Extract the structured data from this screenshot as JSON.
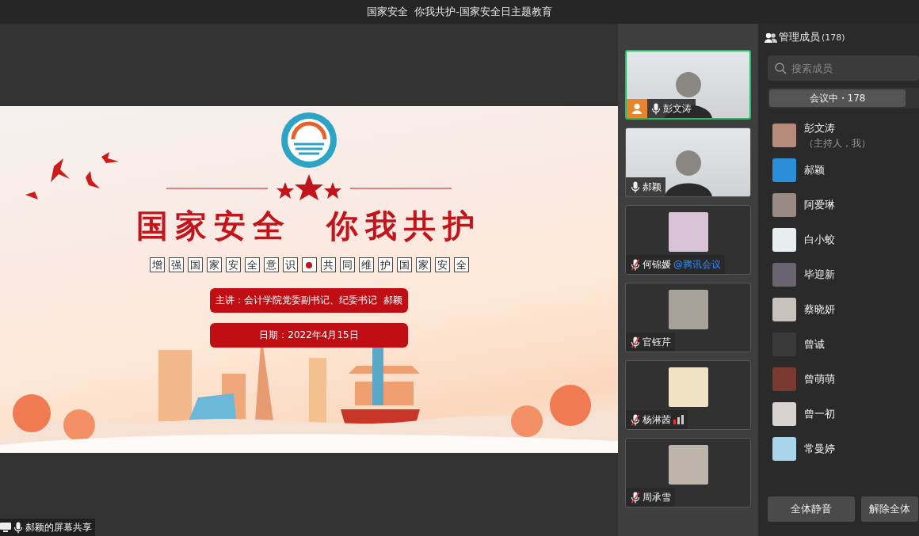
{
  "window": {
    "title": "国家安全  你我共护-国家安全日主题教育"
  },
  "slide": {
    "title_left": "国家安全",
    "title_right": "你我共护",
    "subtitle_left": "增强国家安全意识",
    "subtitle_right": "共同维护国家安全",
    "speaker": "主讲：会计学院党委副书记、纪委书记  郝颖",
    "date": "日期：2022年4月15日"
  },
  "share": {
    "label": "郝颖的屏幕共享"
  },
  "videos": [
    {
      "name": "彭文涛",
      "kind": "camera",
      "active": true,
      "host": true,
      "muted": false,
      "signal": false
    },
    {
      "name": "郝颖",
      "kind": "camera",
      "active": false,
      "host": false,
      "muted": false,
      "signal": false
    },
    {
      "name": "何锦媛",
      "suffix": "@腾讯会议",
      "kind": "avatar",
      "active": false,
      "host": false,
      "muted": true,
      "signal": false
    },
    {
      "name": "官钰芹",
      "kind": "avatar",
      "active": false,
      "host": false,
      "muted": true,
      "signal": false
    },
    {
      "name": "杨淋茜",
      "kind": "avatar",
      "active": false,
      "host": false,
      "muted": true,
      "signal": true
    },
    {
      "name": "周承雪",
      "kind": "avatar",
      "active": false,
      "host": false,
      "muted": true,
      "signal": false
    }
  ],
  "members": {
    "title": "管理成员",
    "count": "(178)",
    "search": {
      "placeholder": "搜索成员"
    },
    "tabs": [
      {
        "label": "会议中・178",
        "selected": true
      }
    ],
    "items": [
      {
        "name": "彭文涛",
        "note": "（主持人，我）"
      },
      {
        "name": "郝颖"
      },
      {
        "name": "阿爱琳"
      },
      {
        "name": "白小蛟"
      },
      {
        "name": "毕迎新"
      },
      {
        "name": "蔡晓妍"
      },
      {
        "name": "曾诚"
      },
      {
        "name": "曾萌萌"
      },
      {
        "name": "曾一初"
      },
      {
        "name": "常曼婷"
      }
    ],
    "buttons": [
      "全体静音",
      "解除全体"
    ]
  }
}
